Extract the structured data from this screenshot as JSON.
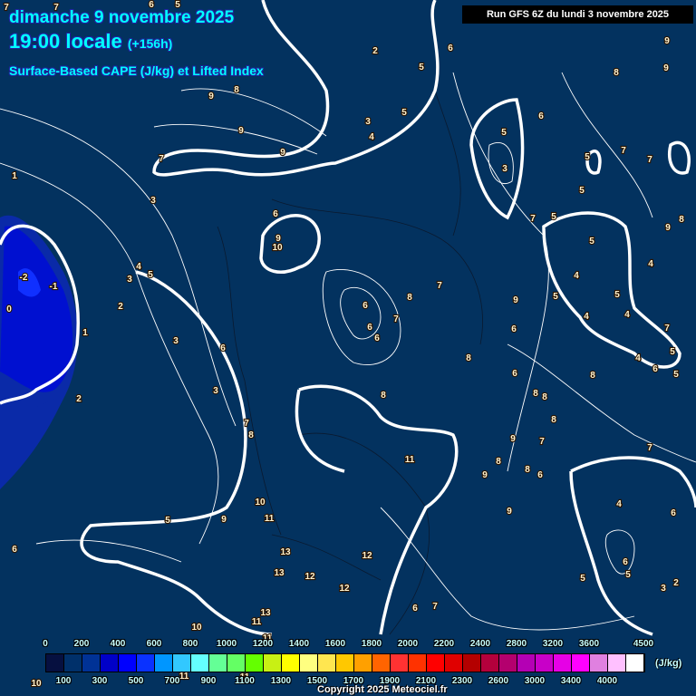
{
  "header": {
    "date": "dimanche 9 novembre 2025",
    "time": "19:00 locale",
    "lead": "(+156h)",
    "parameter": "Surface-Based CAPE (J/kg) et Lifted Index",
    "run": "Run GFS 6Z du lundi 3 novembre 2025"
  },
  "legend": {
    "colors": [
      "#061040",
      "#00306a",
      "#003296",
      "#0000c8",
      "#0000ff",
      "#0a32ff",
      "#0096ff",
      "#32c8ff",
      "#64ffff",
      "#64ff96",
      "#64ff64",
      "#64ff00",
      "#c8f014",
      "#ffff00",
      "#ffff80",
      "#ffe650",
      "#ffc800",
      "#ffa000",
      "#ff6400",
      "#ff3232",
      "#ff3200",
      "#ff0000",
      "#e00000",
      "#b40000",
      "#b4003c",
      "#b4006e",
      "#b400b4",
      "#c800c8",
      "#e600e6",
      "#ff00ff",
      "#e080e0",
      "#ffc0ff",
      "#ffffff"
    ],
    "top_labels": [
      "0",
      "200",
      "400",
      "600",
      "800",
      "1000",
      "1200",
      "1400",
      "1600",
      "1800",
      "2000",
      "2200",
      "2400",
      "2800",
      "3200",
      "3600",
      "4500"
    ],
    "bottom_labels": [
      "100",
      "300",
      "500",
      "700",
      "900",
      "1100",
      "1300",
      "1500",
      "1700",
      "1900",
      "2100",
      "2300",
      "2600",
      "3000",
      "3400",
      "4000"
    ],
    "unit": "(J/kg)"
  },
  "copyright": "Copyright 2025 Meteociel.fr",
  "map": {
    "labels": [
      "7",
      "7",
      "6",
      "5",
      "2",
      "6",
      "5",
      "9",
      "8",
      "9",
      "9",
      "8",
      "9",
      "9",
      "7",
      "3",
      "4",
      "5",
      "6",
      "5",
      "3",
      "5",
      "7",
      "7",
      "5",
      "1",
      "3",
      "6",
      "9",
      "10",
      "7",
      "5",
      "5",
      "8",
      "9",
      "4",
      "5",
      "3",
      "-2",
      "-1",
      "4",
      "4",
      "5",
      "5",
      "9",
      "0",
      "2",
      "6",
      "8",
      "7",
      "4",
      "4",
      "7",
      "6",
      "7",
      "6",
      "6",
      "1",
      "3",
      "6",
      "5",
      "8",
      "4",
      "6",
      "5",
      "6",
      "8",
      "3",
      "8",
      "8",
      "2",
      "8",
      "7",
      "8",
      "8",
      "9",
      "7",
      "7",
      "11",
      "8",
      "9",
      "8",
      "6",
      "10",
      "4",
      "6",
      "9",
      "11",
      "5",
      "9",
      "6",
      "13",
      "12",
      "6",
      "13",
      "12",
      "5",
      "5",
      "2",
      "3",
      "12",
      "6",
      "7",
      "13",
      "11",
      "10",
      "11",
      "10",
      "11",
      "11"
    ]
  }
}
